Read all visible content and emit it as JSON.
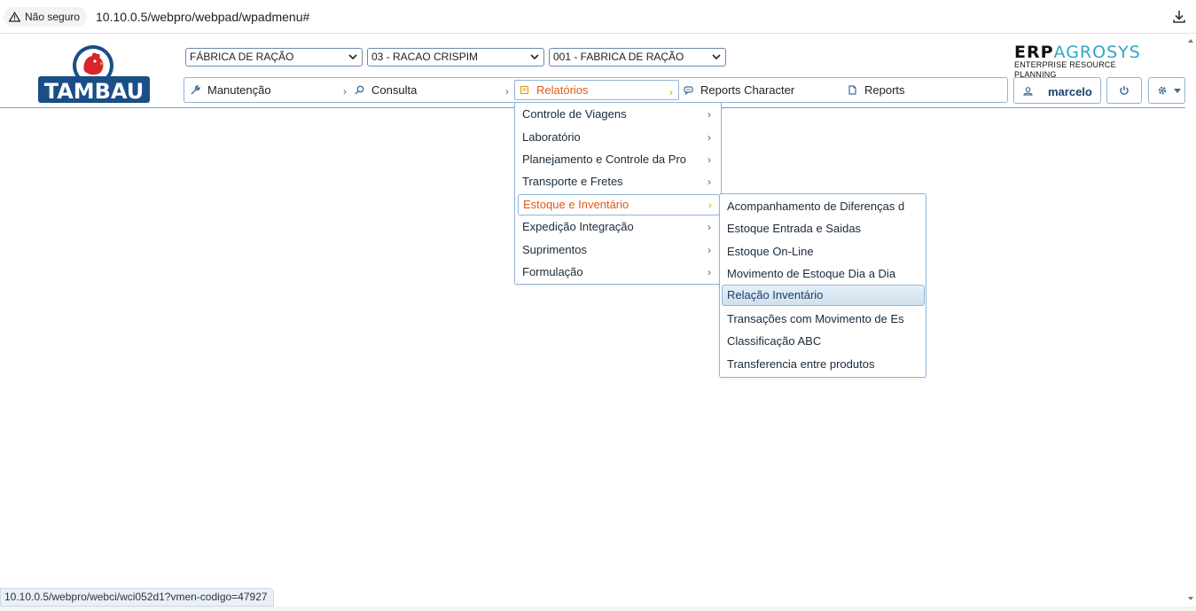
{
  "browser": {
    "security_label": "Não seguro",
    "url": "10.10.0.5/webpro/webpad/wpadmenu#",
    "status_url": "10.10.0.5/webpro/webci/wci052d1?vmen-codigo=47927"
  },
  "logo": {
    "text": "TAMBAU",
    "alt_text": "TAMBAÚ"
  },
  "selects": {
    "company": "FÁBRICA DE RAÇÃO",
    "unit": "03 - RACAO CRISPIM",
    "branch": "001 - FABRICA DE RAÇÃO"
  },
  "brand": {
    "erp": "ERP",
    "agrosys": "AGROSYS",
    "tagline": "ENTERPRISE RESOURCE PLANNING"
  },
  "menubar": {
    "manutencao": "Manutenção",
    "consulta": "Consulta",
    "relatorios": "Relatórios",
    "reports_character": "Reports Character",
    "reports": "Reports"
  },
  "user": {
    "name": "marcelo"
  },
  "relatorios_menu": [
    {
      "label": "Controle de Viagens"
    },
    {
      "label": "Laboratório"
    },
    {
      "label": "Planejamento e Controle da Pro"
    },
    {
      "label": "Transporte e Fretes"
    },
    {
      "label": "Estoque e Inventário"
    },
    {
      "label": "Expedição Integração"
    },
    {
      "label": "Suprimentos"
    },
    {
      "label": "Formulação"
    }
  ],
  "estoque_menu": [
    {
      "label": "Acompanhamento de Diferenças d"
    },
    {
      "label": "Estoque Entrada e Saidas"
    },
    {
      "label": "Estoque On-Line"
    },
    {
      "label": "Movimento de Estoque Dia a Dia"
    },
    {
      "label": "Relação Inventário"
    },
    {
      "label": "Transações com Movimento de Es"
    },
    {
      "label": "Classificação ABC"
    },
    {
      "label": "Transferencia entre produtos"
    }
  ],
  "colors": {
    "accent_orange": "#e05a1a",
    "border_blue": "#8fb4d8",
    "logo_blue": "#1a4e86",
    "logo_red": "#d7262b",
    "brand_teal": "#2ea7c6"
  }
}
